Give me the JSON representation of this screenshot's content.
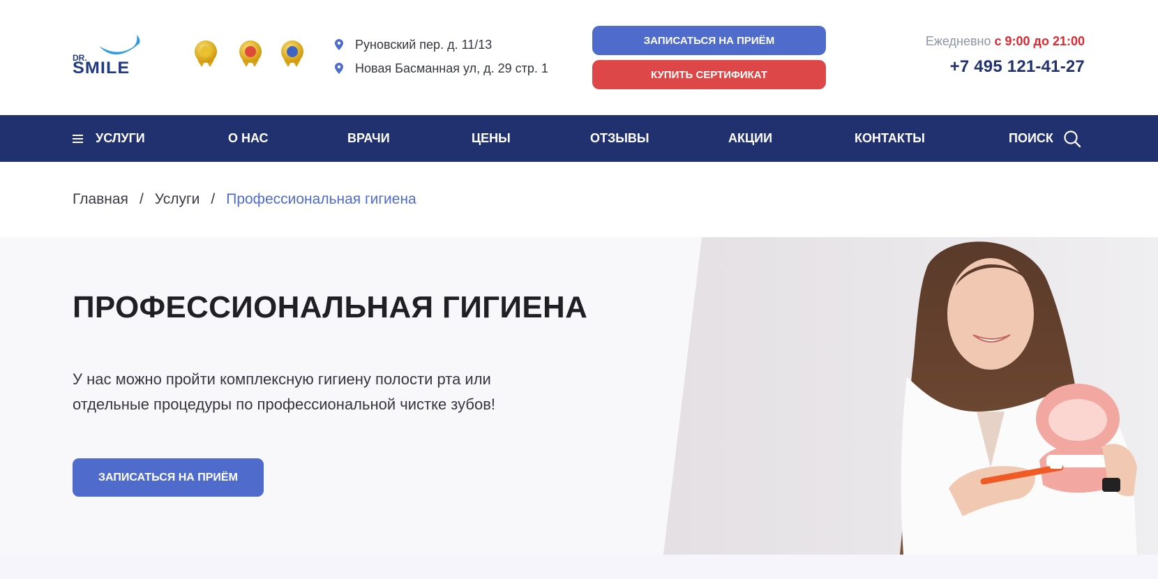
{
  "header": {
    "logo": {
      "line1": "DR.",
      "line2": "SMILE"
    },
    "medals": [
      "award-medal-1",
      "award-medal-2",
      "award-medal-3"
    ],
    "addresses": [
      "Руновский пер. д. 11/13",
      "Новая Басманная ул, д. 29 стр. 1"
    ],
    "book_button": "ЗАПИСАТЬСЯ НА ПРИЁМ",
    "certificate_button": "КУПИТЬ СЕРТИФИКАТ",
    "hours_label": "Ежедневно",
    "hours_time": "с 9:00 до 21:00",
    "phone": "+7 495 121-41-27"
  },
  "nav": {
    "items": [
      "УСЛУГИ",
      "О НАС",
      "ВРАЧИ",
      "ЦЕНЫ",
      "ОТЗЫВЫ",
      "АКЦИИ",
      "КОНТАКТЫ",
      "ПОИСК"
    ]
  },
  "breadcrumb": {
    "items": [
      "Главная",
      "Услуги",
      "Профессиональная гигиена"
    ],
    "separator": "/"
  },
  "hero": {
    "title": "ПРОФЕССИОНАЛЬНАЯ ГИГИЕНА",
    "text_line1": "У нас можно пройти комплексную гигиену полости рта или",
    "text_line2": "отдельные процедуры по профессиональной чистке зубов!",
    "button": "ЗАПИСАТЬСЯ НА ПРИЁМ"
  },
  "colors": {
    "primary": "#4f6ccd",
    "nav_bg": "#213170",
    "accent_red": "#dd4747",
    "hours_red": "#e0262e"
  }
}
